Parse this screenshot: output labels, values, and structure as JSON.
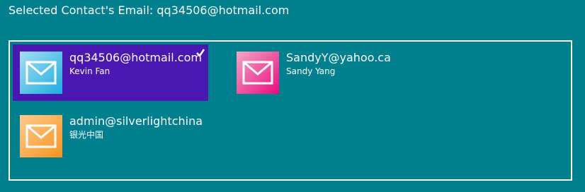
{
  "header": {
    "label": "Selected Contact's Email:",
    "value": "qq34506@hotmail.com"
  },
  "contacts": [
    {
      "email": "qq34506@hotmail.com",
      "name": "Kevin Fan",
      "selected": true,
      "tile_gradient": [
        "#a6ddf2",
        "#1aaee0"
      ],
      "icon": "mail-icon"
    },
    {
      "email": "SandyY@yahoo.ca",
      "name": "Sandy Yang",
      "selected": false,
      "tile_gradient": [
        "#f3a7c6",
        "#ea0a7d"
      ],
      "icon": "mail-icon"
    },
    {
      "email": "admin@silverlightchina",
      "name": "银光中国",
      "selected": false,
      "tile_gradient": [
        "#ffca8e",
        "#f7941e"
      ],
      "icon": "mail-icon"
    }
  ],
  "colors": {
    "background": "#00808f",
    "selected": "#4a17b3",
    "border": "#ffffff"
  }
}
